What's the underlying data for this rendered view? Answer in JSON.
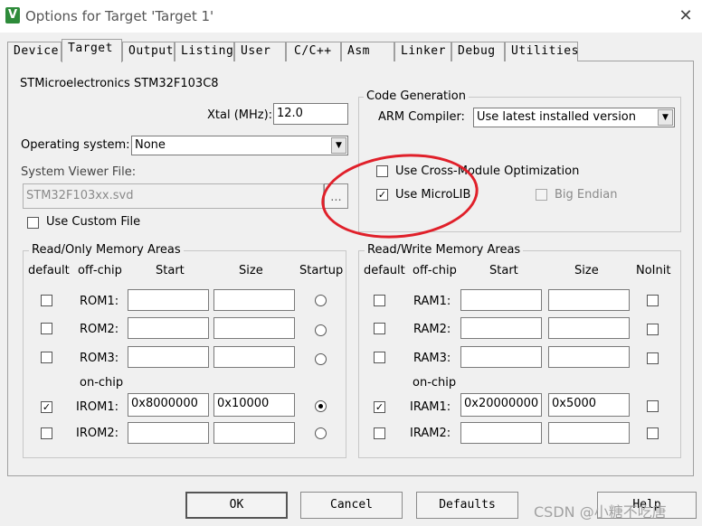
{
  "window": {
    "title": "Options for Target 'Target 1'",
    "icon": "keil-v-icon",
    "icon_glyph": "V",
    "close_glyph": "✕"
  },
  "tabs": [
    {
      "label": "Device"
    },
    {
      "label": "Target"
    },
    {
      "label": "Output"
    },
    {
      "label": "Listing"
    },
    {
      "label": "User"
    },
    {
      "label": "C/C++"
    },
    {
      "label": "Asm"
    },
    {
      "label": "Linker"
    },
    {
      "label": "Debug"
    },
    {
      "label": "Utilities"
    }
  ],
  "device": {
    "name": "STMicroelectronics STM32F103C8",
    "xtal_label": "Xtal (MHz):",
    "xtal_value": "12.0",
    "os_label": "Operating system:",
    "os_value": "None",
    "svd_label": "System Viewer File:",
    "svd_value": "STM32F103xx.svd",
    "browse_label": "...",
    "custom_file_label": "Use Custom File"
  },
  "code_generation": {
    "title": "Code Generation",
    "compiler_label": "ARM Compiler:",
    "compiler_value": "Use latest installed version",
    "cross_module_label": "Use Cross-Module Optimization",
    "cross_module_checked": false,
    "microlib_label": "Use MicroLIB",
    "microlib_checked": true,
    "big_endian_label": "Big Endian",
    "big_endian_checked": false
  },
  "rom": {
    "title": "Read/Only Memory Areas",
    "headers": {
      "default": "default",
      "offchip": "off-chip",
      "start": "Start",
      "size": "Size",
      "last": "Startup"
    },
    "onchip_label": "on-chip",
    "rows": [
      {
        "label": "ROM1:",
        "start": "",
        "size": "",
        "default": false,
        "selected": false
      },
      {
        "label": "ROM2:",
        "start": "",
        "size": "",
        "default": false,
        "selected": false
      },
      {
        "label": "ROM3:",
        "start": "",
        "size": "",
        "default": false,
        "selected": false
      },
      {
        "label": "IROM1:",
        "start": "0x8000000",
        "size": "0x10000",
        "default": true,
        "selected": true
      },
      {
        "label": "IROM2:",
        "start": "",
        "size": "",
        "default": false,
        "selected": false
      }
    ]
  },
  "ram": {
    "title": "Read/Write Memory Areas",
    "headers": {
      "default": "default",
      "offchip": "off-chip",
      "start": "Start",
      "size": "Size",
      "last": "NoInit"
    },
    "onchip_label": "on-chip",
    "rows": [
      {
        "label": "RAM1:",
        "start": "",
        "size": "",
        "default": false,
        "noinit": false
      },
      {
        "label": "RAM2:",
        "start": "",
        "size": "",
        "default": false,
        "noinit": false
      },
      {
        "label": "RAM3:",
        "start": "",
        "size": "",
        "default": false,
        "noinit": false
      },
      {
        "label": "IRAM1:",
        "start": "0x20000000",
        "size": "0x5000",
        "default": true,
        "noinit": false
      },
      {
        "label": "IRAM2:",
        "start": "",
        "size": "",
        "default": false,
        "noinit": false
      }
    ]
  },
  "buttons": {
    "ok": "OK",
    "cancel": "Cancel",
    "defaults": "Defaults",
    "help": "Help"
  },
  "watermark": "CSDN @小糖不吃唐",
  "colors": {
    "annotation": "#e0202a",
    "icon_green": "#2e8b3a"
  }
}
